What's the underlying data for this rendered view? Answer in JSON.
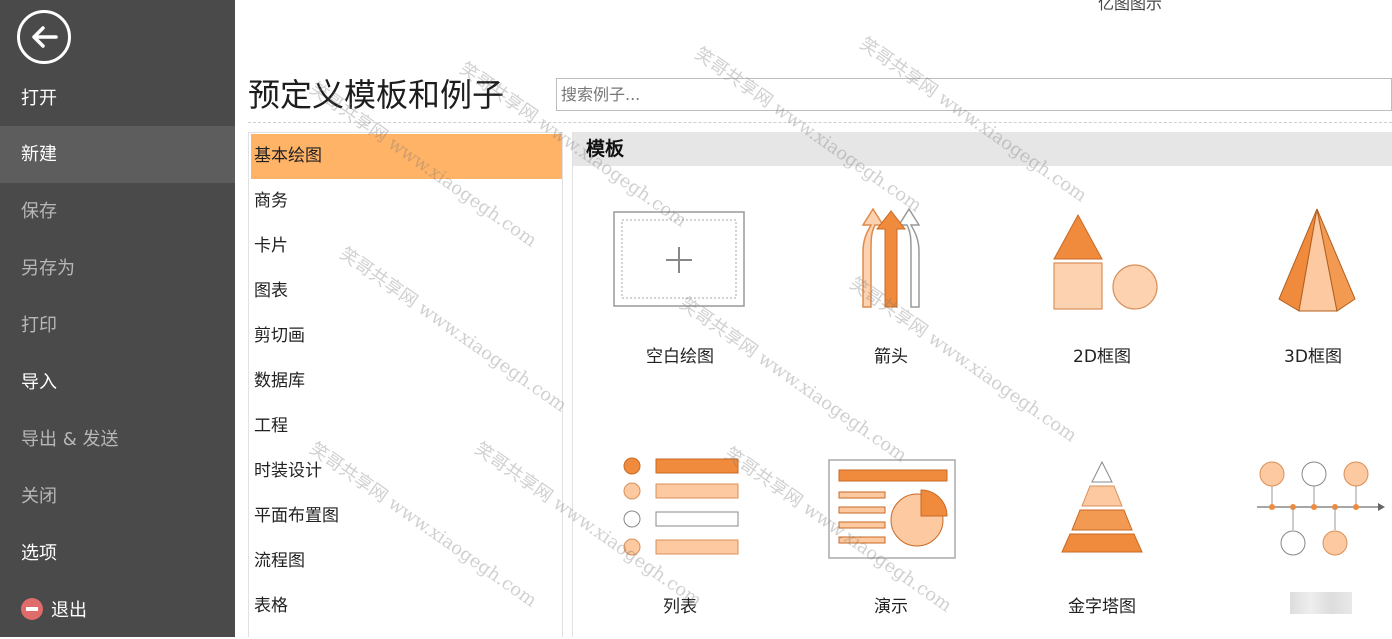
{
  "header": {
    "caption": "亿图图示",
    "title": "预定义模板和例子",
    "search_placeholder": "搜索例子..."
  },
  "sidebar": {
    "items": [
      {
        "label": "打开",
        "state": "normal"
      },
      {
        "label": "新建",
        "state": "active"
      },
      {
        "label": "保存",
        "state": "disabled"
      },
      {
        "label": "另存为",
        "state": "disabled"
      },
      {
        "label": "打印",
        "state": "disabled"
      },
      {
        "label": "导入",
        "state": "normal"
      },
      {
        "label": "导出 & 发送",
        "state": "disabled"
      },
      {
        "label": "关闭",
        "state": "disabled"
      },
      {
        "label": "选项",
        "state": "normal"
      },
      {
        "label": "退出",
        "state": "normal"
      }
    ]
  },
  "categories": [
    "基本绘图",
    "商务",
    "卡片",
    "图表",
    "剪切画",
    "数据库",
    "工程",
    "时装设计",
    "平面布置图",
    "流程图",
    "表格"
  ],
  "selected_category": "基本绘图",
  "section": {
    "title": "模板"
  },
  "templates": [
    {
      "label": "空白绘图",
      "icon": "blank-drawing-icon"
    },
    {
      "label": "箭头",
      "icon": "arrows-icon"
    },
    {
      "label": "2D框图",
      "icon": "2d-block-icon"
    },
    {
      "label": "3D框图",
      "icon": "3d-block-icon"
    },
    {
      "label": "列表",
      "icon": "list-icon"
    },
    {
      "label": "演示",
      "icon": "presentation-icon"
    },
    {
      "label": "金字塔图",
      "icon": "pyramid-icon"
    },
    {
      "label": "",
      "icon": "timeline-icon"
    }
  ],
  "watermark": "笑哥共享网 www.xiaogegh.com",
  "colors": {
    "sidebar_bg": "#4a4a4a",
    "accent_orange": "#f08a3c",
    "light_orange": "#fcc9a0",
    "selected_bg": "#ffb366"
  }
}
